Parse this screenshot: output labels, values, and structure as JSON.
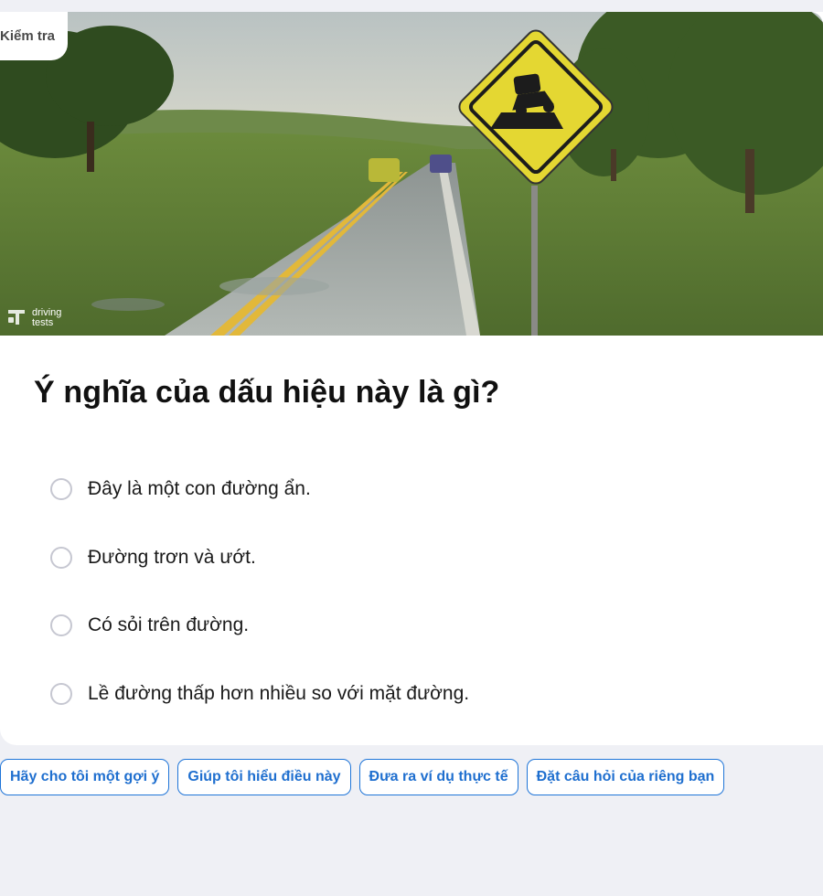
{
  "tag": {
    "label": "Kiểm tra"
  },
  "hero": {
    "image_description_icon": "road-sign-scene",
    "watermark": {
      "line1": "driving",
      "line2": "tests"
    }
  },
  "question": {
    "text": "Ý nghĩa của dấu hiệu này là gì?"
  },
  "options": [
    {
      "label": "Đây là một con đường ẩn."
    },
    {
      "label": "Đường trơn và ướt."
    },
    {
      "label": "Có sỏi trên đường."
    },
    {
      "label": "Lề đường thấp hơn nhiều so với mặt đường."
    }
  ],
  "chips": [
    {
      "label": "Hãy cho tôi một gợi ý"
    },
    {
      "label": "Giúp tôi hiểu điều này"
    },
    {
      "label": "Đưa ra ví dụ thực tế"
    },
    {
      "label": "Đặt câu hỏi của riêng bạn"
    }
  ],
  "colors": {
    "page_bg": "#eff0f5",
    "accent": "#1f75d8",
    "sign_yellow": "#e4d732"
  }
}
